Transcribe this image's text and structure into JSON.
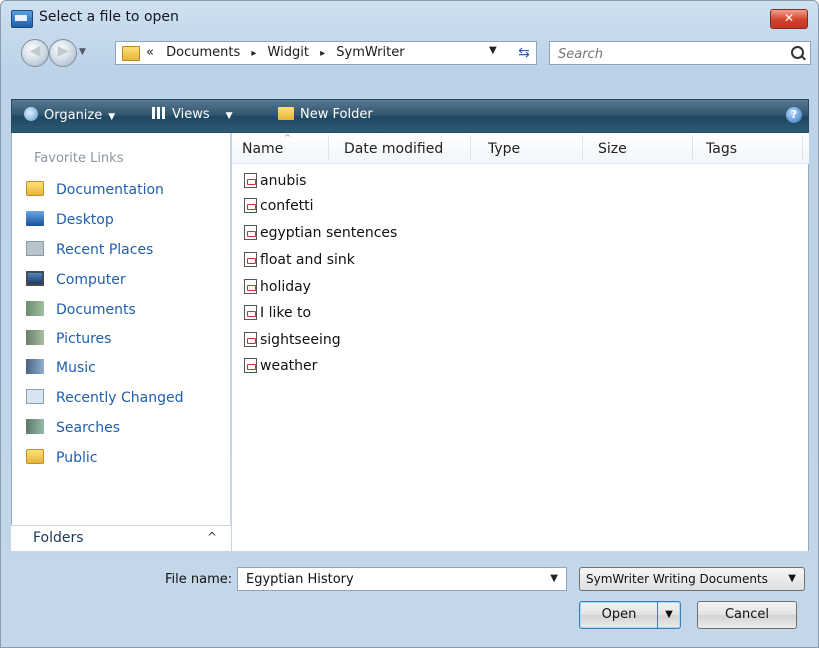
{
  "window": {
    "title": "Select a file to open",
    "close_label": "✕"
  },
  "address": {
    "crumb_prefix": "«",
    "crumbs": [
      "Documents",
      "Widgit",
      "SymWriter"
    ],
    "separator": "▸",
    "search_placeholder": "Search"
  },
  "toolbar": {
    "organize": "Organize",
    "views": "Views",
    "new_folder": "New Folder",
    "help": "?"
  },
  "sidebar": {
    "title": "Favorite Links",
    "items": [
      {
        "label": "Documentation",
        "icon": "folder-icon"
      },
      {
        "label": "Desktop",
        "icon": "desktop-icon"
      },
      {
        "label": "Recent Places",
        "icon": "recent-places-icon"
      },
      {
        "label": "Computer",
        "icon": "computer-icon"
      },
      {
        "label": "Documents",
        "icon": "documents-icon"
      },
      {
        "label": "Pictures",
        "icon": "pictures-icon"
      },
      {
        "label": "Music",
        "icon": "music-icon"
      },
      {
        "label": "Recently Changed",
        "icon": "recently-changed-icon"
      },
      {
        "label": "Searches",
        "icon": "searches-icon"
      },
      {
        "label": "Public",
        "icon": "folder-icon"
      }
    ],
    "folders_label": "Folders",
    "folders_caret": "^"
  },
  "files": {
    "columns": [
      "Name",
      "Date modified",
      "Type",
      "Size",
      "Tags"
    ],
    "rows": [
      "anubis",
      "confetti",
      "egyptian sentences",
      "float and sink",
      "holiday",
      "I like to",
      "sightseeing",
      "weather"
    ]
  },
  "bottom": {
    "file_name_label": "File name:",
    "file_name_value": "Egyptian History",
    "file_type": "SymWriter Writing Documents",
    "open_label": "Open",
    "cancel_label": "Cancel"
  }
}
